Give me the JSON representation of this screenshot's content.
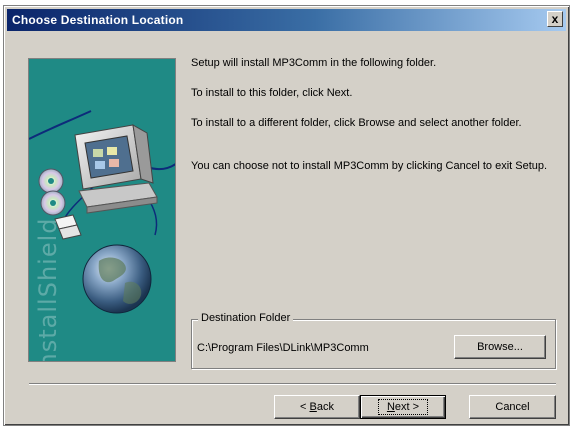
{
  "window": {
    "title": "Choose Destination Location",
    "close_label": "x"
  },
  "banner": {
    "logo_text": "InstallShield"
  },
  "body": {
    "line1": "Setup will install MP3Comm in the following folder.",
    "line2": "To install to this folder, click Next.",
    "line3": "To install to a different folder, click Browse and select another folder.",
    "line4": "You can choose not to install MP3Comm by clicking Cancel to exit Setup."
  },
  "destination": {
    "legend": "Destination Folder",
    "path": "C:\\Program Files\\DLink\\MP3Comm",
    "browse_label": "Browse..."
  },
  "buttons": {
    "back_prefix": "< ",
    "back_mnemonic": "B",
    "back_rest": "ack",
    "next_mnemonic": "N",
    "next_rest": "ext >",
    "cancel_label": "Cancel"
  },
  "colors": {
    "title_gradient_start": "#0a246a",
    "title_gradient_end": "#a6caf0",
    "dialog_face": "#d4d0c8",
    "banner_teal": "#1f8a85"
  }
}
